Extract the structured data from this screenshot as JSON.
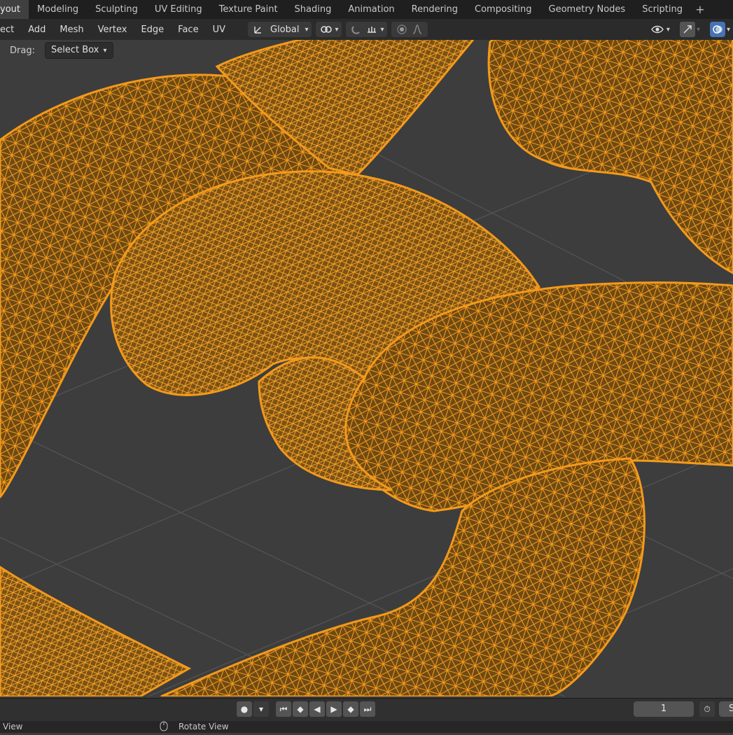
{
  "workspace_tabs": [
    "yout",
    "Modeling",
    "Sculpting",
    "UV Editing",
    "Texture Paint",
    "Shading",
    "Animation",
    "Rendering",
    "Compositing",
    "Geometry Nodes",
    "Scripting"
  ],
  "add_tab_icon": "+",
  "header_menu": [
    "ect",
    "Add",
    "Mesh",
    "Vertex",
    "Edge",
    "Face",
    "UV"
  ],
  "transform_orientation": "Global",
  "tool_settings": {
    "drag_label": "Drag:",
    "drag_value": "Select Box"
  },
  "timeline": {
    "current_frame": "1",
    "right_cut_text": "S"
  },
  "status_bar": {
    "left_text": "View",
    "middle_text": "Rotate View"
  },
  "colors": {
    "wire": "#f39a1c",
    "viewport_bg": "#3d3d3d",
    "accent_blue": "#4772b3"
  },
  "icons": [
    "transform-orientation-icon",
    "pivot-link-icon",
    "snap-magnet-icon",
    "snap-target-icon",
    "proportional-edit-icon",
    "falloff-icon",
    "visibility-eye-icon",
    "gizmo-icon",
    "overlay-icon",
    "record-icon",
    "jump-start-icon",
    "prev-keyframe-icon",
    "play-reverse-icon",
    "play-icon",
    "next-keyframe-icon",
    "jump-end-icon",
    "timer-icon"
  ]
}
